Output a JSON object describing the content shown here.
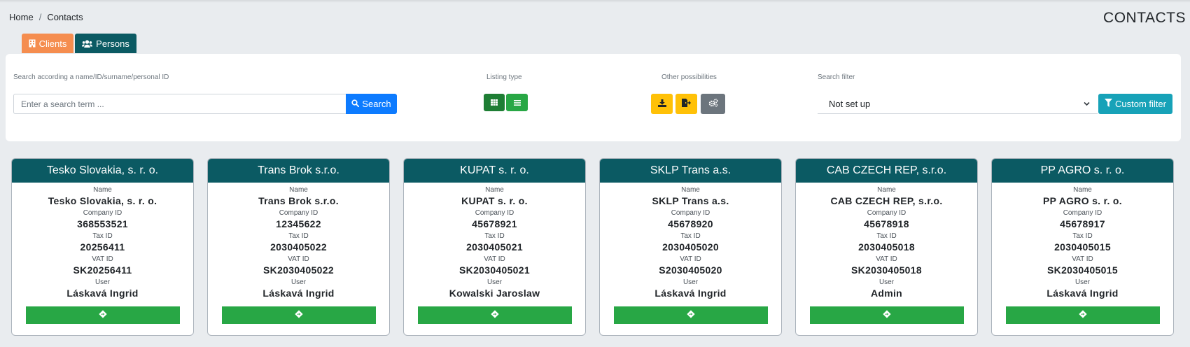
{
  "breadcrumb": {
    "home": "Home",
    "separator": "/",
    "current": "Contacts"
  },
  "page_title": "CONTACTS",
  "tabs": [
    {
      "label": "Clients",
      "icon": "building-icon",
      "color": "#f58d4f"
    },
    {
      "label": "Persons",
      "icon": "users-icon",
      "color": "#0b5a63",
      "active": true
    }
  ],
  "search": {
    "label": "Search according a name/ID/surname/personal ID",
    "placeholder": "Enter a search term ...",
    "value": "",
    "button_label": "Search"
  },
  "listing_type": {
    "label": "Listing type",
    "options": [
      "grid-icon",
      "list-icon"
    ],
    "active": "grid-icon"
  },
  "other_possibilities": {
    "label": "Other possibilities",
    "buttons": [
      "download-icon",
      "export-icon",
      "cogs-icon"
    ]
  },
  "search_filter": {
    "label": "Search filter",
    "selected": "Not set up",
    "custom_button_label": "Custom filter"
  },
  "field_labels": {
    "name": "Name",
    "company_id": "Company ID",
    "tax_id": "Tax ID",
    "vat_id": "VAT ID",
    "user": "User"
  },
  "cards": [
    {
      "title": "Tesko Slovakia, s. r. o.",
      "name": "Tesko Slovakia, s. r. o.",
      "company_id": "368553521",
      "tax_id": "20256411",
      "vat_id": "SK20256411",
      "user": "Láskavá Ingrid"
    },
    {
      "title": "Trans Brok s.r.o.",
      "name": "Trans Brok s.r.o.",
      "company_id": "12345622",
      "tax_id": "2030405022",
      "vat_id": "SK2030405022",
      "user": "Láskavá Ingrid"
    },
    {
      "title": "KUPAT s. r. o.",
      "name": "KUPAT s. r. o.",
      "company_id": "45678921",
      "tax_id": "2030405021",
      "vat_id": "SK2030405021",
      "user": "Kowalski Jaroslaw"
    },
    {
      "title": "SKLP Trans a.s.",
      "name": "SKLP Trans a.s.",
      "company_id": "45678920",
      "tax_id": "2030405020",
      "vat_id": "S2030405020",
      "user": "Láskavá Ingrid"
    },
    {
      "title": "CAB CZECH REP, s.r.o.",
      "name": "CAB CZECH REP, s.r.o.",
      "company_id": "45678918",
      "tax_id": "2030405018",
      "vat_id": "SK2030405018",
      "user": "Admin"
    },
    {
      "title": "PP AGRO s. r. o.",
      "name": "PP AGRO s. r. o.",
      "company_id": "45678917",
      "tax_id": "2030405015",
      "vat_id": "SK2030405015",
      "user": "Láskavá Ingrid"
    }
  ],
  "colors": {
    "accent_teal": "#0b5a63",
    "orange": "#f58d4f",
    "primary": "#0d7bff",
    "success": "#28a745",
    "warning": "#ffc107",
    "info": "#17a2b8"
  }
}
